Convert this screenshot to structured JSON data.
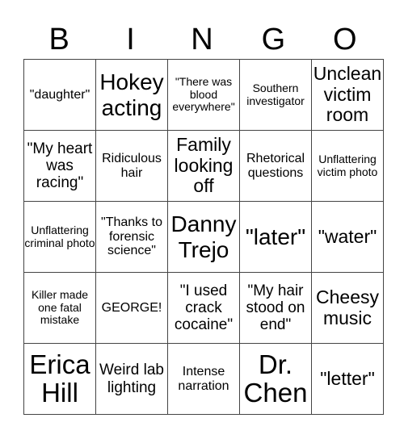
{
  "header": {
    "letters": [
      "B",
      "I",
      "N",
      "G",
      "O"
    ]
  },
  "grid": {
    "rows": [
      [
        {
          "text": "\"daughter\"",
          "size": "s-s"
        },
        {
          "text": "Hokey acting",
          "size": "s-xl"
        },
        {
          "text": "\"There was blood everywhere\"",
          "size": "s-xs"
        },
        {
          "text": "Southern investigator",
          "size": "s-xs"
        },
        {
          "text": "Unclean victim room",
          "size": "s-l"
        }
      ],
      [
        {
          "text": "\"My heart was racing\"",
          "size": "s-m"
        },
        {
          "text": "Ridiculous hair",
          "size": "s-s"
        },
        {
          "text": "Family looking off",
          "size": "s-l"
        },
        {
          "text": "Rhetorical questions",
          "size": "s-s"
        },
        {
          "text": "Unflattering victim photo",
          "size": "s-xs"
        }
      ],
      [
        {
          "text": "Unflattering criminal photo",
          "size": "s-xs"
        },
        {
          "text": "\"Thanks to forensic science\"",
          "size": "s-s"
        },
        {
          "text": "Danny Trejo",
          "size": "s-xl"
        },
        {
          "text": "\"later\"",
          "size": "s-xl"
        },
        {
          "text": "\"water\"",
          "size": "s-l"
        }
      ],
      [
        {
          "text": "Killer made one fatal mistake",
          "size": "s-xs"
        },
        {
          "text": "GEORGE!",
          "size": "s-s"
        },
        {
          "text": "\"I used crack cocaine\"",
          "size": "s-m"
        },
        {
          "text": "\"My hair stood on end\"",
          "size": "s-m"
        },
        {
          "text": "Cheesy music",
          "size": "s-l"
        }
      ],
      [
        {
          "text": "Erica Hill",
          "size": "s-xxl"
        },
        {
          "text": "Weird lab lighting",
          "size": "s-m"
        },
        {
          "text": "Intense narration",
          "size": "s-s"
        },
        {
          "text": "Dr. Chen",
          "size": "s-xxl"
        },
        {
          "text": "\"letter\"",
          "size": "s-l"
        }
      ]
    ]
  }
}
